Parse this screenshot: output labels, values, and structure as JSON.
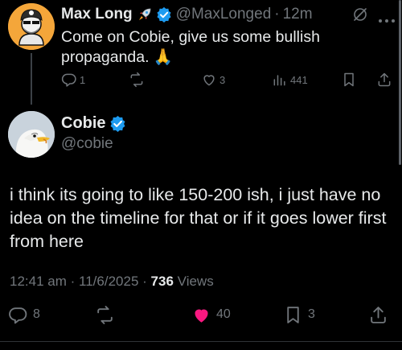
{
  "reply": {
    "author_name": "Max Long",
    "handle": "@MaxLonged",
    "separator": "·",
    "time": "12m",
    "text": "Come on Cobie, give us some bullish propaganda. 🙏",
    "replies": "1",
    "reposts": "",
    "likes": "3",
    "views": "441"
  },
  "main": {
    "author_name": "Cobie",
    "handle": "@cobie",
    "text": "i think its going to like 150-200 ish, i just have no idea on the timeline for that or if it goes lower first from here",
    "time": "12:41 am",
    "date": "11/6/2025",
    "separator": "·",
    "views_count": "736",
    "views_label": "Views",
    "replies": "8",
    "likes": "40",
    "bookmarks": "3"
  },
  "colors": {
    "background": "#000000",
    "text": "#e7e9ea",
    "muted": "#71767b",
    "verified": "#1d9bf0",
    "like": "#f91880"
  },
  "icons": [
    "rocket-icon",
    "verified-badge-icon",
    "grok-icon",
    "more-icon",
    "reply-icon",
    "repost-icon",
    "like-icon",
    "views-icon",
    "bookmark-icon",
    "share-icon"
  ]
}
